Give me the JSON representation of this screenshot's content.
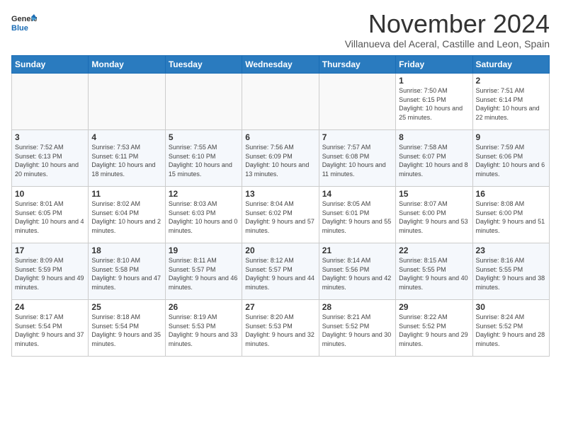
{
  "header": {
    "logo_general": "General",
    "logo_blue": "Blue",
    "month_title": "November 2024",
    "subtitle": "Villanueva del Aceral, Castille and Leon, Spain"
  },
  "weekdays": [
    "Sunday",
    "Monday",
    "Tuesday",
    "Wednesday",
    "Thursday",
    "Friday",
    "Saturday"
  ],
  "weeks": [
    [
      {
        "day": "",
        "sunrise": "",
        "sunset": "",
        "daylight": ""
      },
      {
        "day": "",
        "sunrise": "",
        "sunset": "",
        "daylight": ""
      },
      {
        "day": "",
        "sunrise": "",
        "sunset": "",
        "daylight": ""
      },
      {
        "day": "",
        "sunrise": "",
        "sunset": "",
        "daylight": ""
      },
      {
        "day": "",
        "sunrise": "",
        "sunset": "",
        "daylight": ""
      },
      {
        "day": "1",
        "sunrise": "Sunrise: 7:50 AM",
        "sunset": "Sunset: 6:15 PM",
        "daylight": "Daylight: 10 hours and 25 minutes."
      },
      {
        "day": "2",
        "sunrise": "Sunrise: 7:51 AM",
        "sunset": "Sunset: 6:14 PM",
        "daylight": "Daylight: 10 hours and 22 minutes."
      }
    ],
    [
      {
        "day": "3",
        "sunrise": "Sunrise: 7:52 AM",
        "sunset": "Sunset: 6:13 PM",
        "daylight": "Daylight: 10 hours and 20 minutes."
      },
      {
        "day": "4",
        "sunrise": "Sunrise: 7:53 AM",
        "sunset": "Sunset: 6:11 PM",
        "daylight": "Daylight: 10 hours and 18 minutes."
      },
      {
        "day": "5",
        "sunrise": "Sunrise: 7:55 AM",
        "sunset": "Sunset: 6:10 PM",
        "daylight": "Daylight: 10 hours and 15 minutes."
      },
      {
        "day": "6",
        "sunrise": "Sunrise: 7:56 AM",
        "sunset": "Sunset: 6:09 PM",
        "daylight": "Daylight: 10 hours and 13 minutes."
      },
      {
        "day": "7",
        "sunrise": "Sunrise: 7:57 AM",
        "sunset": "Sunset: 6:08 PM",
        "daylight": "Daylight: 10 hours and 11 minutes."
      },
      {
        "day": "8",
        "sunrise": "Sunrise: 7:58 AM",
        "sunset": "Sunset: 6:07 PM",
        "daylight": "Daylight: 10 hours and 8 minutes."
      },
      {
        "day": "9",
        "sunrise": "Sunrise: 7:59 AM",
        "sunset": "Sunset: 6:06 PM",
        "daylight": "Daylight: 10 hours and 6 minutes."
      }
    ],
    [
      {
        "day": "10",
        "sunrise": "Sunrise: 8:01 AM",
        "sunset": "Sunset: 6:05 PM",
        "daylight": "Daylight: 10 hours and 4 minutes."
      },
      {
        "day": "11",
        "sunrise": "Sunrise: 8:02 AM",
        "sunset": "Sunset: 6:04 PM",
        "daylight": "Daylight: 10 hours and 2 minutes."
      },
      {
        "day": "12",
        "sunrise": "Sunrise: 8:03 AM",
        "sunset": "Sunset: 6:03 PM",
        "daylight": "Daylight: 10 hours and 0 minutes."
      },
      {
        "day": "13",
        "sunrise": "Sunrise: 8:04 AM",
        "sunset": "Sunset: 6:02 PM",
        "daylight": "Daylight: 9 hours and 57 minutes."
      },
      {
        "day": "14",
        "sunrise": "Sunrise: 8:05 AM",
        "sunset": "Sunset: 6:01 PM",
        "daylight": "Daylight: 9 hours and 55 minutes."
      },
      {
        "day": "15",
        "sunrise": "Sunrise: 8:07 AM",
        "sunset": "Sunset: 6:00 PM",
        "daylight": "Daylight: 9 hours and 53 minutes."
      },
      {
        "day": "16",
        "sunrise": "Sunrise: 8:08 AM",
        "sunset": "Sunset: 6:00 PM",
        "daylight": "Daylight: 9 hours and 51 minutes."
      }
    ],
    [
      {
        "day": "17",
        "sunrise": "Sunrise: 8:09 AM",
        "sunset": "Sunset: 5:59 PM",
        "daylight": "Daylight: 9 hours and 49 minutes."
      },
      {
        "day": "18",
        "sunrise": "Sunrise: 8:10 AM",
        "sunset": "Sunset: 5:58 PM",
        "daylight": "Daylight: 9 hours and 47 minutes."
      },
      {
        "day": "19",
        "sunrise": "Sunrise: 8:11 AM",
        "sunset": "Sunset: 5:57 PM",
        "daylight": "Daylight: 9 hours and 46 minutes."
      },
      {
        "day": "20",
        "sunrise": "Sunrise: 8:12 AM",
        "sunset": "Sunset: 5:57 PM",
        "daylight": "Daylight: 9 hours and 44 minutes."
      },
      {
        "day": "21",
        "sunrise": "Sunrise: 8:14 AM",
        "sunset": "Sunset: 5:56 PM",
        "daylight": "Daylight: 9 hours and 42 minutes."
      },
      {
        "day": "22",
        "sunrise": "Sunrise: 8:15 AM",
        "sunset": "Sunset: 5:55 PM",
        "daylight": "Daylight: 9 hours and 40 minutes."
      },
      {
        "day": "23",
        "sunrise": "Sunrise: 8:16 AM",
        "sunset": "Sunset: 5:55 PM",
        "daylight": "Daylight: 9 hours and 38 minutes."
      }
    ],
    [
      {
        "day": "24",
        "sunrise": "Sunrise: 8:17 AM",
        "sunset": "Sunset: 5:54 PM",
        "daylight": "Daylight: 9 hours and 37 minutes."
      },
      {
        "day": "25",
        "sunrise": "Sunrise: 8:18 AM",
        "sunset": "Sunset: 5:54 PM",
        "daylight": "Daylight: 9 hours and 35 minutes."
      },
      {
        "day": "26",
        "sunrise": "Sunrise: 8:19 AM",
        "sunset": "Sunset: 5:53 PM",
        "daylight": "Daylight: 9 hours and 33 minutes."
      },
      {
        "day": "27",
        "sunrise": "Sunrise: 8:20 AM",
        "sunset": "Sunset: 5:53 PM",
        "daylight": "Daylight: 9 hours and 32 minutes."
      },
      {
        "day": "28",
        "sunrise": "Sunrise: 8:21 AM",
        "sunset": "Sunset: 5:52 PM",
        "daylight": "Daylight: 9 hours and 30 minutes."
      },
      {
        "day": "29",
        "sunrise": "Sunrise: 8:22 AM",
        "sunset": "Sunset: 5:52 PM",
        "daylight": "Daylight: 9 hours and 29 minutes."
      },
      {
        "day": "30",
        "sunrise": "Sunrise: 8:24 AM",
        "sunset": "Sunset: 5:52 PM",
        "daylight": "Daylight: 9 hours and 28 minutes."
      }
    ]
  ]
}
